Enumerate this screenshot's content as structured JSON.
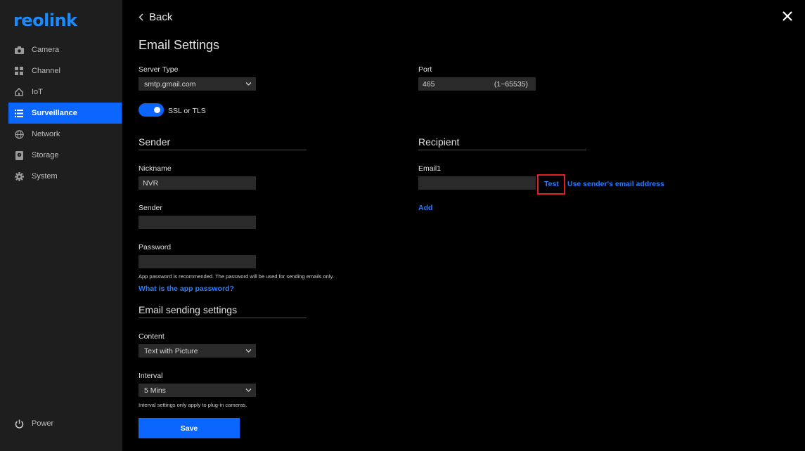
{
  "sidebar": {
    "logo": "reolink",
    "items": [
      {
        "label": "Camera",
        "icon": "camera-icon"
      },
      {
        "label": "Channel",
        "icon": "grid-icon"
      },
      {
        "label": "IoT",
        "icon": "home-icon"
      },
      {
        "label": "Surveillance",
        "icon": "list-icon",
        "active": true
      },
      {
        "label": "Network",
        "icon": "globe-icon"
      },
      {
        "label": "Storage",
        "icon": "storage-icon"
      },
      {
        "label": "System",
        "icon": "gear-icon"
      }
    ],
    "power": "Power"
  },
  "header": {
    "back": "Back",
    "title": "Email Settings"
  },
  "server": {
    "type_label": "Server Type",
    "type_value": "smtp.gmail.com",
    "port_label": "Port",
    "port_value": "465",
    "port_range": "(1~65535)",
    "ssl_label": "SSL or TLS",
    "ssl_on": true
  },
  "sender": {
    "title": "Sender",
    "nickname_label": "Nickname",
    "nickname_value": "NVR",
    "sender_label": "Sender",
    "sender_value": "",
    "password_label": "Password",
    "password_value": "",
    "password_hint": "App password is recommended. The password will be used for sending emails only.",
    "app_password_link": "What is the app password?"
  },
  "recipient": {
    "title": "Recipient",
    "email1_label": "Email1",
    "email1_value": "",
    "test": "Test",
    "use_sender": "Use sender's email address",
    "add": "Add"
  },
  "sending": {
    "title": "Email sending settings",
    "content_label": "Content",
    "content_value": "Text with Picture",
    "interval_label": "Interval",
    "interval_value": "5 Mins",
    "interval_hint": "Interval settings only apply to plug-in cameras."
  },
  "save": "Save",
  "colors": {
    "accent": "#0a66ff",
    "link": "#2b7bff",
    "highlight": "#e02020",
    "sidebar_bg": "#1e1e1e",
    "field_bg": "#2a2a2a"
  }
}
